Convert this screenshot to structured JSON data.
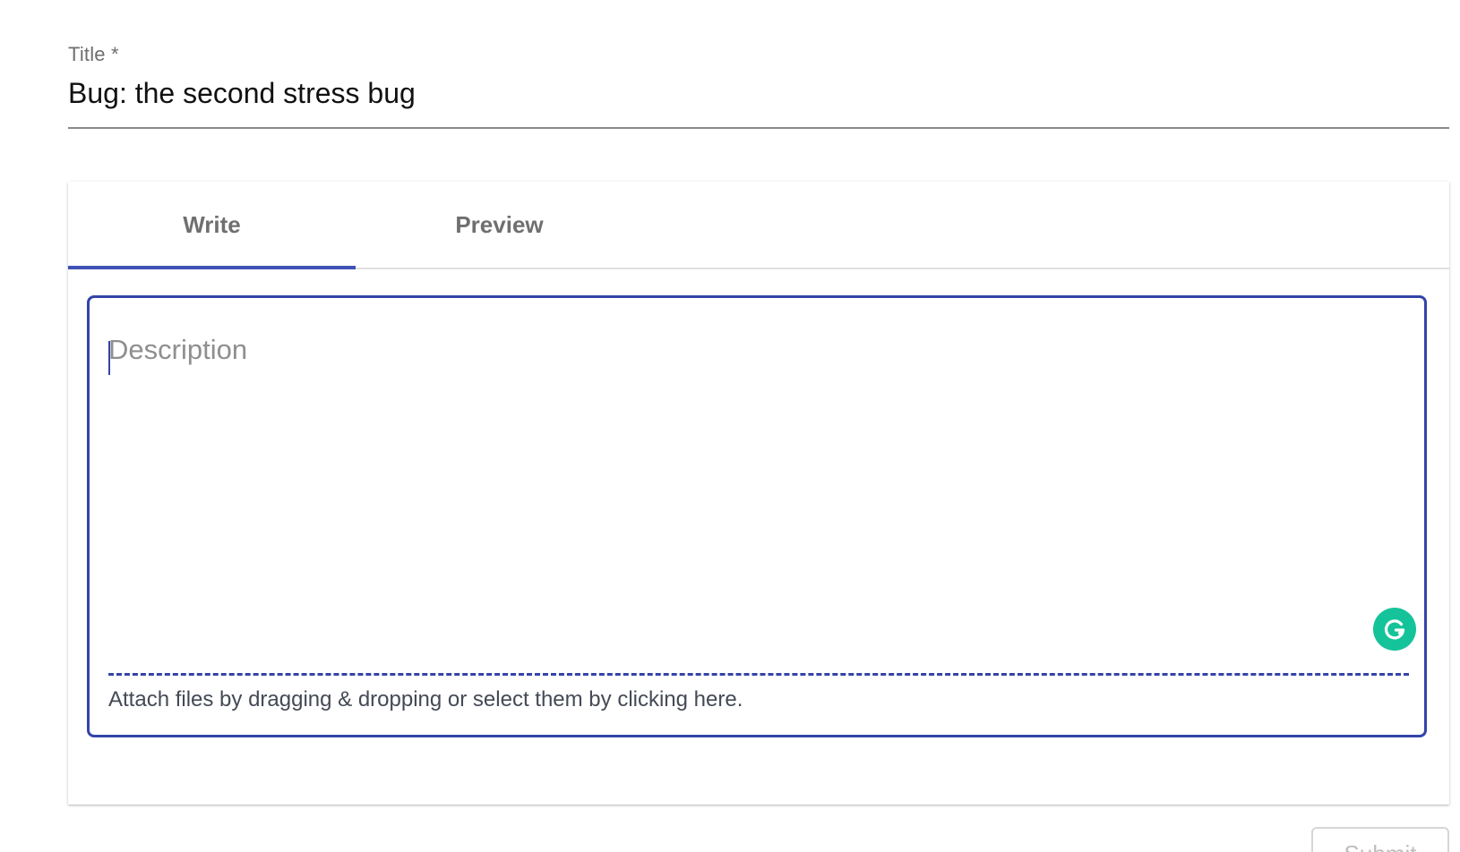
{
  "title_field": {
    "label": "Title *",
    "value": "Bug: the second stress bug"
  },
  "editor": {
    "tabs": [
      {
        "label": "Write",
        "active": true
      },
      {
        "label": "Preview",
        "active": false
      }
    ],
    "description_placeholder": "Description",
    "description_value": "",
    "attach_text": "Attach files by dragging & dropping or select them by clicking here.",
    "grammarly_icon": "grammarly-icon"
  },
  "submit": {
    "label": "Submit"
  },
  "colors": {
    "accent": "#3f51b5",
    "editor_border": "#3344a8",
    "grammarly": "#15c39a"
  }
}
